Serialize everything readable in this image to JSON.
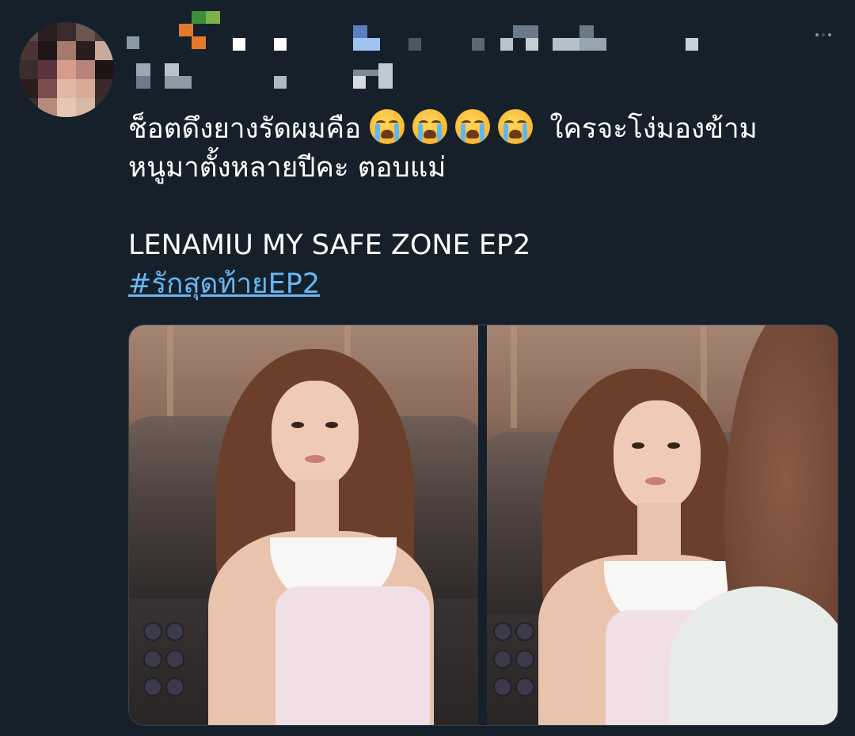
{
  "tweet": {
    "text_lines": [
      "ช็อตดึงยางรัดผมคือ",
      "ใครจะโง่มองข้าม",
      "หนูมาตั้งหลายปีคะ ตอบแม่",
      "LENAMIU MY SAFE ZONE EP2"
    ],
    "hashtag": "#รักสุดท้ายEP2",
    "emoji_name": "loudly-crying-face",
    "emoji_count": 4
  },
  "colors": {
    "background": "#15202b",
    "text": "#ffffff",
    "link": "#67b7f2",
    "border": "#38444d"
  },
  "media": {
    "images": [
      {
        "name": "left-photo"
      },
      {
        "name": "right-photo"
      }
    ]
  }
}
